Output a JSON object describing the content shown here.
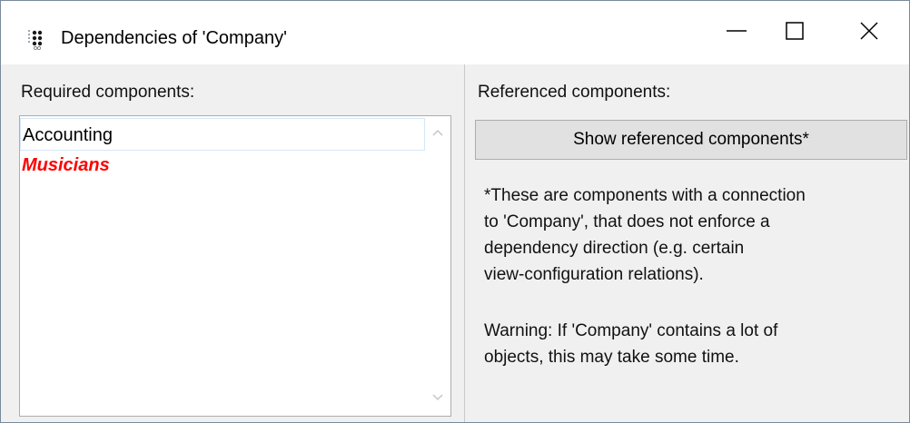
{
  "window": {
    "title": "Dependencies of 'Company'",
    "app_icon": "dependency-grid-icon",
    "controls": {
      "minimize_icon": "minimize-icon",
      "maximize_icon": "maximize-icon",
      "close_icon": "close-icon"
    }
  },
  "left_panel": {
    "label": "Required components:",
    "items": [
      {
        "text": "Accounting",
        "state": "normal"
      },
      {
        "text": "Musicians",
        "state": "missing",
        "color": "#ff0000"
      }
    ],
    "scroll_up_icon": "chevron-up-icon",
    "scroll_down_icon": "chevron-down-icon"
  },
  "right_panel": {
    "label": "Referenced components:",
    "button_label": "Show referenced components*",
    "note_lines": [
      "*These are components with a connection",
      "to 'Company', that does not enforce a",
      "dependency direction (e.g. certain",
      "view-configuration relations)."
    ],
    "warning_lines": [
      "Warning: If 'Company' contains a lot of",
      "objects, this may take some time."
    ]
  }
}
